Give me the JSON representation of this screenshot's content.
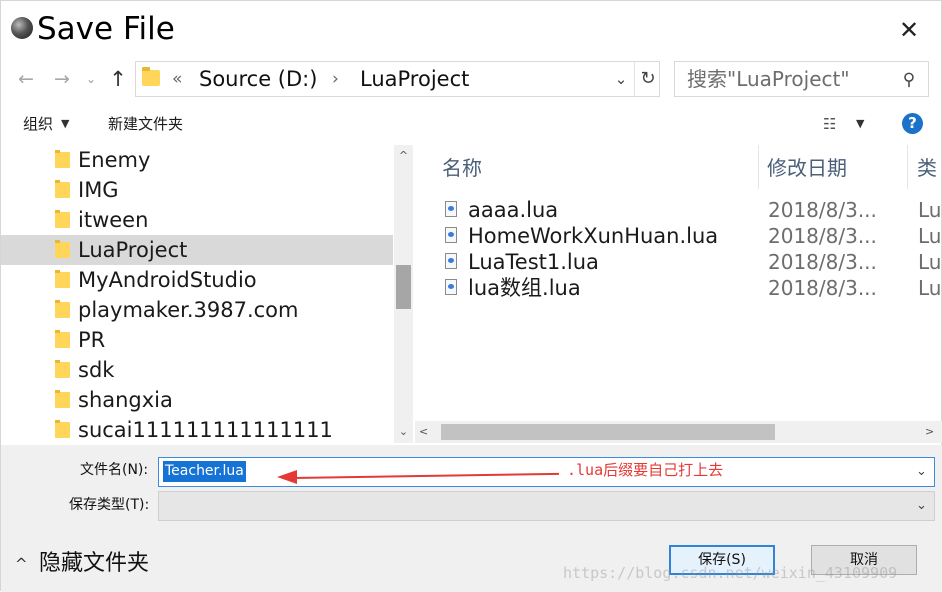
{
  "window": {
    "title": "Save File",
    "close_glyph": "✕"
  },
  "address_bar": {
    "back_glyph": "←",
    "forward_glyph": "→",
    "recent_glyph": "⌄",
    "up_glyph": "↑",
    "chevrons": "«",
    "segments": [
      "Source (D:)",
      "LuaProject"
    ],
    "separator": "›",
    "dropdown_glyph": "⌄",
    "refresh_glyph": "↻"
  },
  "search": {
    "placeholder": "搜索\"LuaProject\"",
    "icon": "search-icon",
    "glyph": "⚲"
  },
  "toolbar": {
    "organize_label": "组织",
    "organize_arrow": "▼",
    "new_folder_label": "新建文件夹",
    "view_glyph": "☷",
    "view_arrow": "▼",
    "help_glyph": "?"
  },
  "nav_pane": {
    "scroll_up": "^",
    "scroll_down": "⌄",
    "items": [
      {
        "label": "Enemy",
        "selected": false
      },
      {
        "label": "IMG",
        "selected": false
      },
      {
        "label": "itween",
        "selected": false
      },
      {
        "label": "LuaProject",
        "selected": true
      },
      {
        "label": "MyAndroidStudio",
        "selected": false
      },
      {
        "label": "playmaker.3987.com",
        "selected": false
      },
      {
        "label": "PR",
        "selected": false
      },
      {
        "label": "sdk",
        "selected": false
      },
      {
        "label": "shangxia",
        "selected": false
      },
      {
        "label": "sucai111111111111111",
        "selected": false
      }
    ]
  },
  "file_list": {
    "sort_glyph": "^",
    "columns": {
      "name": "名称",
      "date": "修改日期",
      "type": "类"
    },
    "files": [
      {
        "name": "aaaa.lua",
        "date": "2018/8/3...",
        "type": "Lu"
      },
      {
        "name": "HomeWorkXunHuan.lua",
        "date": "2018/8/3...",
        "type": "Lu"
      },
      {
        "name": "LuaTest1.lua",
        "date": "2018/8/3...",
        "type": "Lu"
      },
      {
        "name": "lua数组.lua",
        "date": "2018/8/3...",
        "type": "Lu"
      }
    ],
    "scroll_left": "<",
    "scroll_right": ">"
  },
  "form": {
    "filename_label": "文件名(N):",
    "filename_value": "Teacher.lua",
    "filetype_label": "保存类型(T):",
    "filetype_value": "",
    "dropdown_glyph": "⌄",
    "annotation": ".lua后缀要自己打上去",
    "annotation_color": "#e53935",
    "hide_folders_arrow": "^",
    "hide_folders_label": "隐藏文件夹",
    "save_label": "保存(S)",
    "cancel_label": "取消",
    "watermark": "https://blog.csdn.net/weixin_43109909"
  },
  "colors": {
    "accent": "#1573d6",
    "selected_nav": "#d9d9d9",
    "column_header": "#4c607a"
  }
}
